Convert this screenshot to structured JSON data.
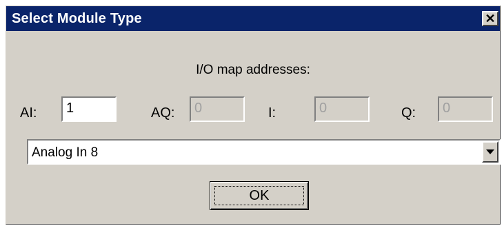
{
  "dialog": {
    "title": "Select Module Type",
    "close_glyph": "✕"
  },
  "caption": "I/O map addresses:",
  "fields": {
    "ai": {
      "label": "AI:",
      "value": "1",
      "enabled": true
    },
    "aq": {
      "label": "AQ:",
      "value": "0",
      "enabled": false
    },
    "i": {
      "label": "I:",
      "value": "0",
      "enabled": false
    },
    "q": {
      "label": "Q:",
      "value": "0",
      "enabled": false
    }
  },
  "module_select": {
    "selected": "Analog In 8",
    "icon": "chevron-down-icon"
  },
  "ok_button": {
    "label": "OK"
  },
  "colors": {
    "titlebar": "#0a246a",
    "face": "#d4d0c8"
  }
}
